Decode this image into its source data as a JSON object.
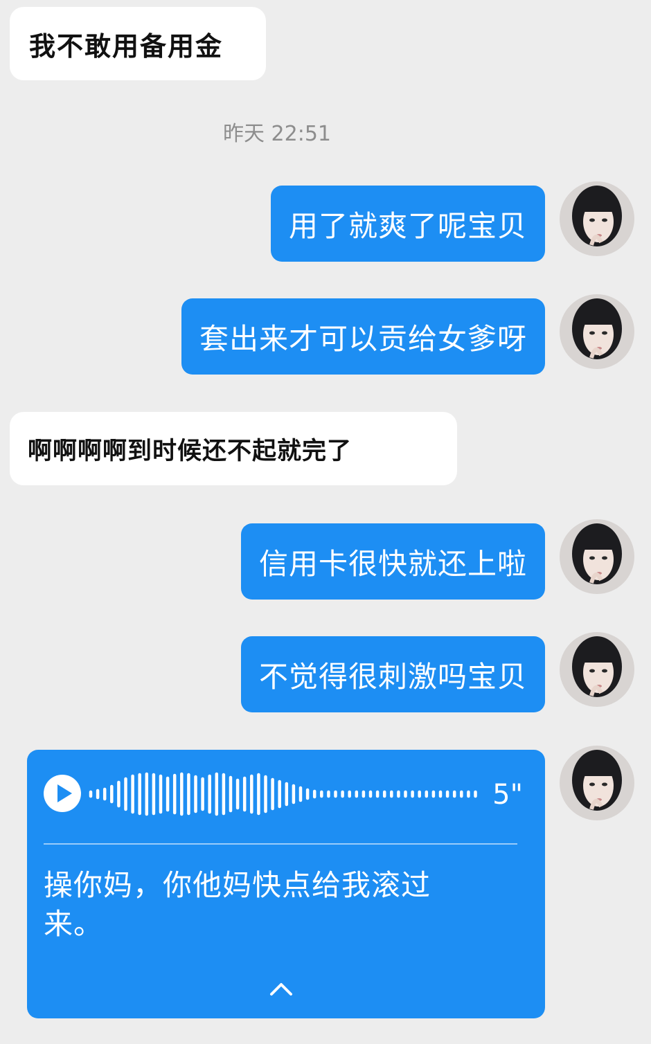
{
  "messages": [
    {
      "side": "left",
      "text": "我不敢用备用金"
    },
    {
      "side": "right",
      "text": "用了就爽了呢宝贝"
    },
    {
      "side": "right",
      "text": "套出来才可以贡给女爹呀"
    },
    {
      "side": "left",
      "text": "啊啊啊啊到时候还不起就完了"
    },
    {
      "side": "right",
      "text": "信用卡很快就还上啦"
    },
    {
      "side": "right",
      "text": "不觉得很刺激吗宝贝"
    }
  ],
  "timestamp": "昨天 22:51",
  "voice_message": {
    "duration": "5\"",
    "transcript": "操你妈，你他妈快点给我滚过来。"
  },
  "colors": {
    "background": "#ededed",
    "incoming_bubble": "#ffffff",
    "outgoing_bubble": "#1d8ef3"
  },
  "icons": {
    "play": "play-icon",
    "collapse": "chevron-up-icon"
  }
}
